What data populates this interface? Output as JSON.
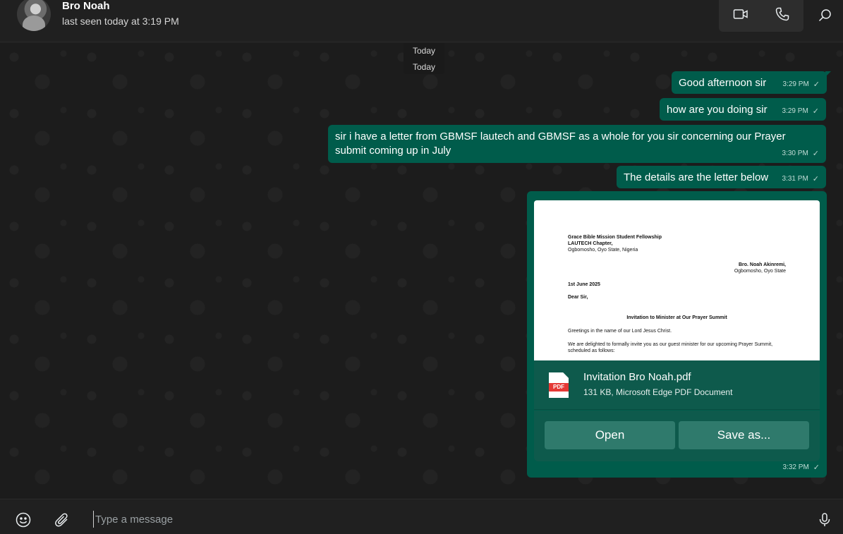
{
  "header": {
    "contact_name": "Bro Noah",
    "status": "last seen today at 3:19 PM"
  },
  "chat": {
    "date_labels": [
      "Today",
      "Today"
    ],
    "messages": [
      {
        "text": "Good afternoon sir",
        "time": "3:29 PM",
        "tick": "✓"
      },
      {
        "text": "how are you doing sir",
        "time": "3:29 PM",
        "tick": "✓"
      },
      {
        "text": "sir i have a letter from GBMSF lautech and GBMSF as a whole for you sir concerning our Prayer submit coming up in July",
        "time": "3:30 PM",
        "tick": "✓"
      },
      {
        "text": "The details are the letter below",
        "time": "3:31 PM",
        "tick": "✓"
      }
    ],
    "attachment": {
      "preview": {
        "org": "Grace Bible Mission Student Fellowship",
        "chapter": "LAUTECH Chapter,",
        "address": "Ogbomosho, Oyo State, Nigeria",
        "recipient": "Bro. Noah Akinremi,",
        "recipient_address": "Ogbomosho, Oyo State",
        "date": "1st June 2025",
        "salutation": "Dear Sir,",
        "subject": "Invitation to Minister at Our Prayer Summit",
        "line1": "Greetings in the name of our Lord Jesus Christ.",
        "line2": "We are delighted to formally invite you as our guest minister for our upcoming Prayer Summit,",
        "line3": "scheduled as follows:"
      },
      "pdf_badge": "PDF",
      "file_name": "Invitation Bro Noah.pdf",
      "file_info": "131 KB, Microsoft Edge PDF Document",
      "open_label": "Open",
      "save_label": "Save as...",
      "time": "3:32 PM",
      "tick": "✓"
    }
  },
  "composer": {
    "placeholder": "Type a message"
  },
  "colors": {
    "bubble": "#005c4b",
    "background": "#1c1c1c",
    "header": "#202020"
  }
}
